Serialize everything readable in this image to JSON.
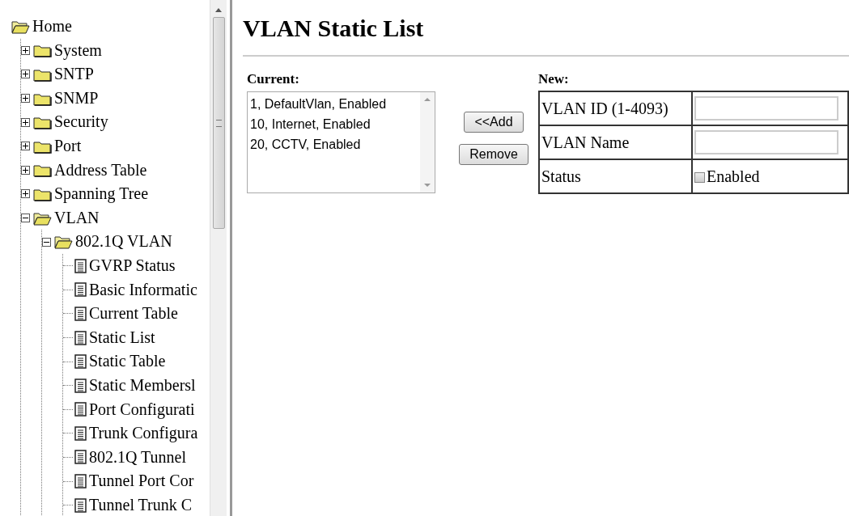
{
  "tree": {
    "label": "Home",
    "expanded": true,
    "children": [
      {
        "label": "System",
        "kind": "folder",
        "expanded": false
      },
      {
        "label": "SNTP",
        "kind": "folder",
        "expanded": false
      },
      {
        "label": "SNMP",
        "kind": "folder",
        "expanded": false
      },
      {
        "label": "Security",
        "kind": "folder",
        "expanded": false
      },
      {
        "label": "Port",
        "kind": "folder",
        "expanded": false
      },
      {
        "label": "Address Table",
        "kind": "folder",
        "expanded": false
      },
      {
        "label": "Spanning Tree",
        "kind": "folder",
        "expanded": false
      },
      {
        "label": "VLAN",
        "kind": "folder",
        "expanded": true,
        "children": [
          {
            "label": "802.1Q VLAN",
            "kind": "folder",
            "expanded": true,
            "children": [
              {
                "label": "GVRP Status",
                "kind": "page"
              },
              {
                "label": "Basic Informatic",
                "kind": "page"
              },
              {
                "label": "Current Table",
                "kind": "page"
              },
              {
                "label": "Static List",
                "kind": "page"
              },
              {
                "label": "Static Table",
                "kind": "page"
              },
              {
                "label": "Static Membersl",
                "kind": "page"
              },
              {
                "label": "Port Configurati",
                "kind": "page"
              },
              {
                "label": "Trunk Configura",
                "kind": "page"
              },
              {
                "label": "802.1Q Tunnel",
                "kind": "page"
              },
              {
                "label": "Tunnel Port Cor",
                "kind": "page"
              },
              {
                "label": "Tunnel Trunk C",
                "kind": "page"
              }
            ]
          }
        ]
      }
    ]
  },
  "page_title": "VLAN Static List",
  "current": {
    "label": "Current:",
    "items": [
      "1, DefaultVlan, Enabled",
      "10, Internet, Enabled",
      "20, CCTV, Enabled"
    ]
  },
  "buttons": [
    "<<Add",
    "Remove"
  ],
  "new": {
    "label": "New:",
    "rows": [
      {
        "kind": "text",
        "label": "VLAN ID (1-4093)"
      },
      {
        "kind": "text",
        "label": "VLAN Name"
      },
      {
        "kind": "checkbox",
        "label": "Status",
        "option": "Enabled",
        "checked": false
      }
    ]
  }
}
